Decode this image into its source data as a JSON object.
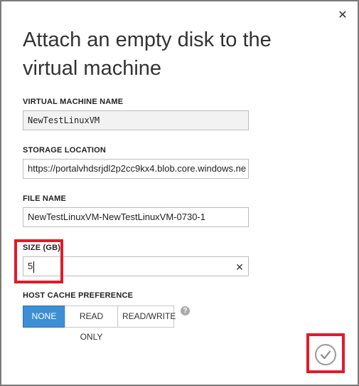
{
  "dialog": {
    "title": "Attach an empty disk to the virtual machine",
    "close_glyph": "✕"
  },
  "vm_name": {
    "label": "VIRTUAL MACHINE NAME",
    "value": "NewTestLinuxVM"
  },
  "storage": {
    "label": "STORAGE LOCATION",
    "value": "https://portalvhdsrjdl2p2cc9kx4.blob.core.windows.ne"
  },
  "file_name": {
    "label": "FILE NAME",
    "value": "NewTestLinuxVM-NewTestLinuxVM-0730-1"
  },
  "size": {
    "label": "SIZE (GB)",
    "value": "5",
    "clear_glyph": "✕"
  },
  "cache": {
    "label": "HOST CACHE PREFERENCE",
    "options": [
      "NONE",
      "READ ONLY",
      "READ/WRITE"
    ],
    "selected": "NONE",
    "help_glyph": "?"
  },
  "highlight_color": "#e11b2a",
  "accent_color": "#3d8fd4",
  "icons": {
    "close": "close-icon",
    "help": "help-icon",
    "confirm": "checkmark-icon"
  }
}
